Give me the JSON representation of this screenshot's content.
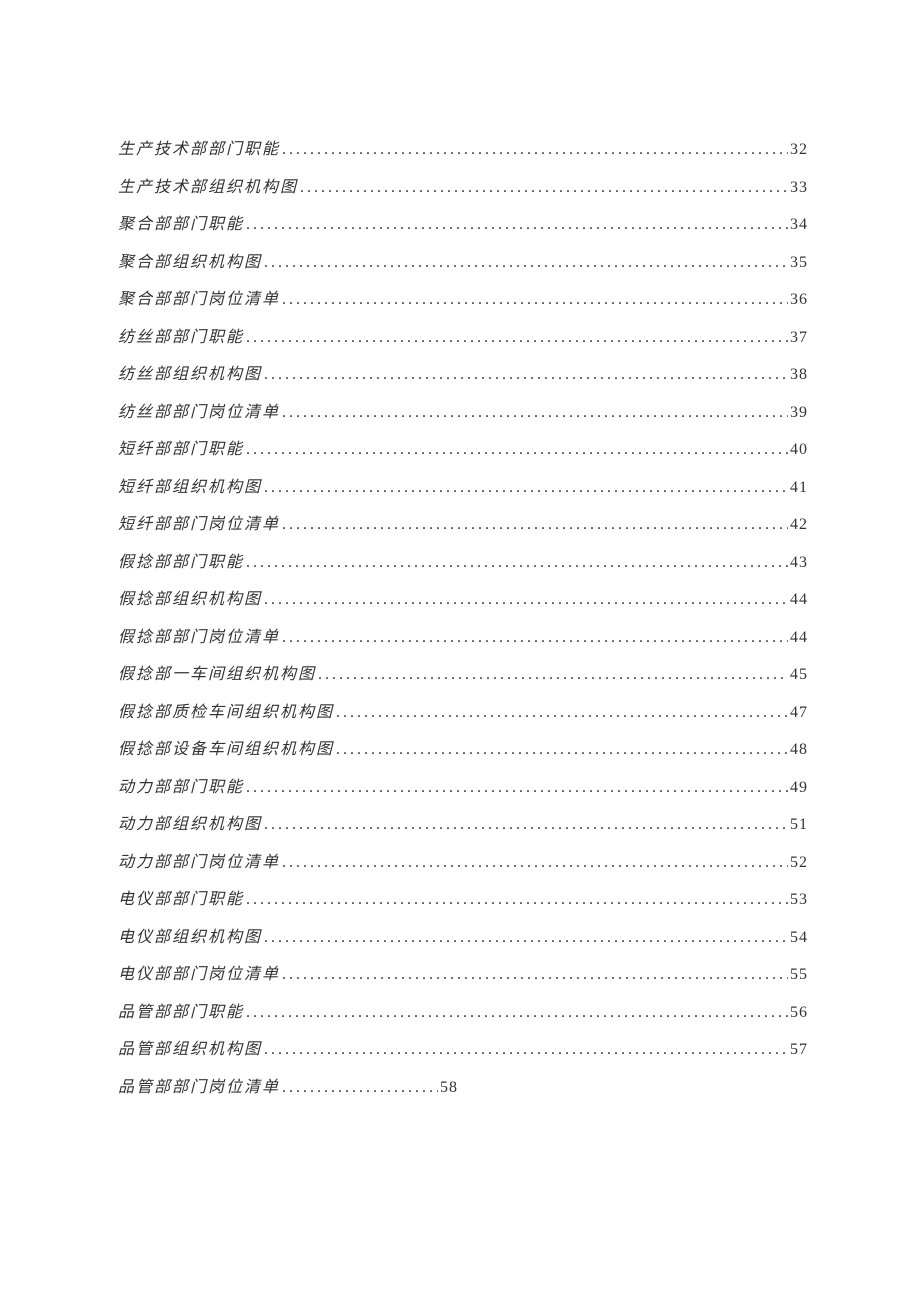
{
  "toc": {
    "entries": [
      {
        "title": "生产技术部部门职能",
        "page": "32"
      },
      {
        "title": "生产技术部组织机构图",
        "page": "33"
      },
      {
        "title": "聚合部部门职能",
        "page": "34"
      },
      {
        "title": "聚合部组织机构图",
        "page": "35"
      },
      {
        "title": "聚合部部门岗位清单",
        "page": "36"
      },
      {
        "title": "纺丝部部门职能",
        "page": "37"
      },
      {
        "title": "纺丝部组织机构图",
        "page": "38"
      },
      {
        "title": "纺丝部部门岗位清单",
        "page": "39"
      },
      {
        "title": "短纤部部门职能",
        "page": "40"
      },
      {
        "title": "短纤部组织机构图",
        "page": "41"
      },
      {
        "title": "短纤部部门岗位清单",
        "page": "42"
      },
      {
        "title": "假捻部部门职能",
        "page": "43"
      },
      {
        "title": "假捻部组织机构图",
        "page": "44"
      },
      {
        "title": "假捻部部门岗位清单",
        "page": "44"
      },
      {
        "title": "假捻部一车间组织机构图",
        "page": "45"
      },
      {
        "title": "假捻部质检车间组织机构图",
        "page": "47"
      },
      {
        "title": "假捻部设备车间组织机构图",
        "page": "48"
      },
      {
        "title": "动力部部门职能",
        "page": "49"
      },
      {
        "title": "动力部组织机构图",
        "page": "51"
      },
      {
        "title": "动力部部门岗位清单",
        "page": "52"
      },
      {
        "title": "电仪部部门职能",
        "page": "53"
      },
      {
        "title": "电仪部组织机构图",
        "page": "54"
      },
      {
        "title": "电仪部部门岗位清单",
        "page": "55"
      },
      {
        "title": "品管部部门职能",
        "page": "56"
      },
      {
        "title": "品管部组织机构图",
        "page": "57"
      },
      {
        "title": "品管部部门岗位清单",
        "page": "58"
      }
    ]
  }
}
